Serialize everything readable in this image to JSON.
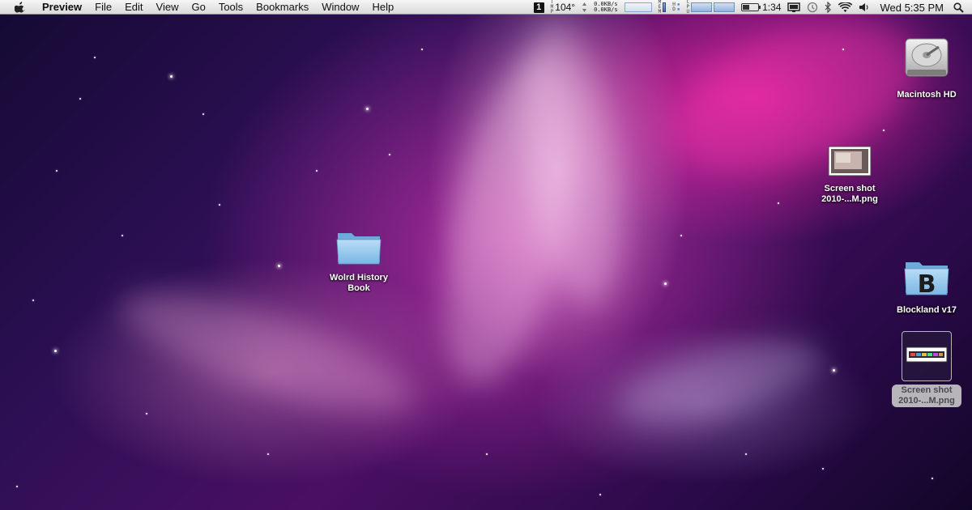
{
  "menubar": {
    "app_name": "Preview",
    "menus": [
      "File",
      "Edit",
      "View",
      "Go",
      "Tools",
      "Bookmarks",
      "Window",
      "Help"
    ],
    "status": {
      "space_number": "1",
      "temp_prefix": "T\nM\nP",
      "temperature": "104°",
      "net_up": "0.0KB/s",
      "net_down": "0.0KB/s",
      "mem_label": "M\nE\nM",
      "hd_label": "H\nD",
      "cpu_label": "C\nP\nU",
      "battery_time": "1:34",
      "clock": "Wed 5:35 PM"
    }
  },
  "desktop": {
    "icons": [
      {
        "id": "macintosh-hd",
        "label": "Macintosh HD",
        "kind": "hard-drive-icon",
        "selected": false
      },
      {
        "id": "screenshot-1",
        "label": "Screen shot\n2010-...M.png",
        "kind": "image-file-icon",
        "selected": false
      },
      {
        "id": "wolrd-history",
        "label": "Wolrd History\nBook",
        "kind": "folder-icon",
        "selected": false
      },
      {
        "id": "blockland",
        "label": "Blockland v17",
        "kind": "app-folder-icon",
        "selected": false
      },
      {
        "id": "screenshot-2",
        "label": "Screen shot\n2010-...M.png",
        "kind": "image-file-icon",
        "selected": true
      }
    ]
  },
  "colors": {
    "menubar_top": "#f6f6f6",
    "menubar_bottom": "#d9d9d9",
    "folder_blue": "#8fc3ea",
    "selection_label": "#d2d2d2"
  }
}
